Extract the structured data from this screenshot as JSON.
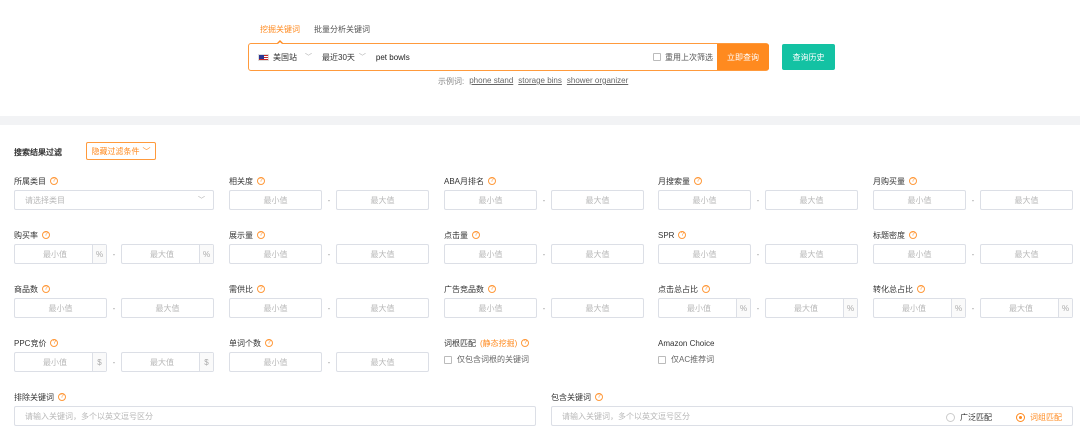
{
  "tabs": {
    "mine": "挖掘关键词",
    "batch": "批量分析关键词"
  },
  "search": {
    "site": "美国站",
    "days": "最近30天",
    "value": "pet bowls",
    "reuse_label": "重用上次筛选",
    "query_button": "立即查询",
    "history_button": "查询历史"
  },
  "examples": {
    "prefix": "示例词:",
    "items": [
      "phone stand",
      "storage bins",
      "shower organizer"
    ]
  },
  "filter": {
    "title": "搜索结果过滤",
    "hide_button": "隐藏过滤条件",
    "min": "最小值",
    "max": "最大值",
    "dash": "-",
    "percent": "%",
    "dollar": "$",
    "category_label": "所属类目",
    "category_placeholder": "请选择类目",
    "relevance": "相关度",
    "aba_rank": "ABA月排名",
    "monthly_search": "月搜索量",
    "monthly_purchase": "月购买量",
    "purchase_rate": "购买率",
    "impressions": "展示量",
    "clicks": "点击量",
    "spr": "SPR",
    "title_density": "标题密度",
    "products": "商品数",
    "supply_demand": "需供比",
    "ad_products": "广告竞品数",
    "click_share": "点击总占比",
    "conversion_share": "转化总占比",
    "ppc": "PPC竞价",
    "word_count": "单词个数",
    "root_match": "词根匹配",
    "root_match_accent": "(静态挖掘)",
    "root_match_check": "仅包含词根的关键词",
    "amazon_choice": "Amazon Choice",
    "ac_check": "仅AC推荐词",
    "exclude_label": "排除关键词",
    "exclude_placeholder": "请输入关键词，多个以英文逗号区分",
    "include_label": "包含关键词",
    "include_placeholder": "请输入关键词，多个以英文逗号区分",
    "broad": "广泛匹配",
    "phrase": "词组匹配"
  },
  "colors": {
    "accent": "#ff8a1f",
    "teal": "#13c2a3"
  }
}
